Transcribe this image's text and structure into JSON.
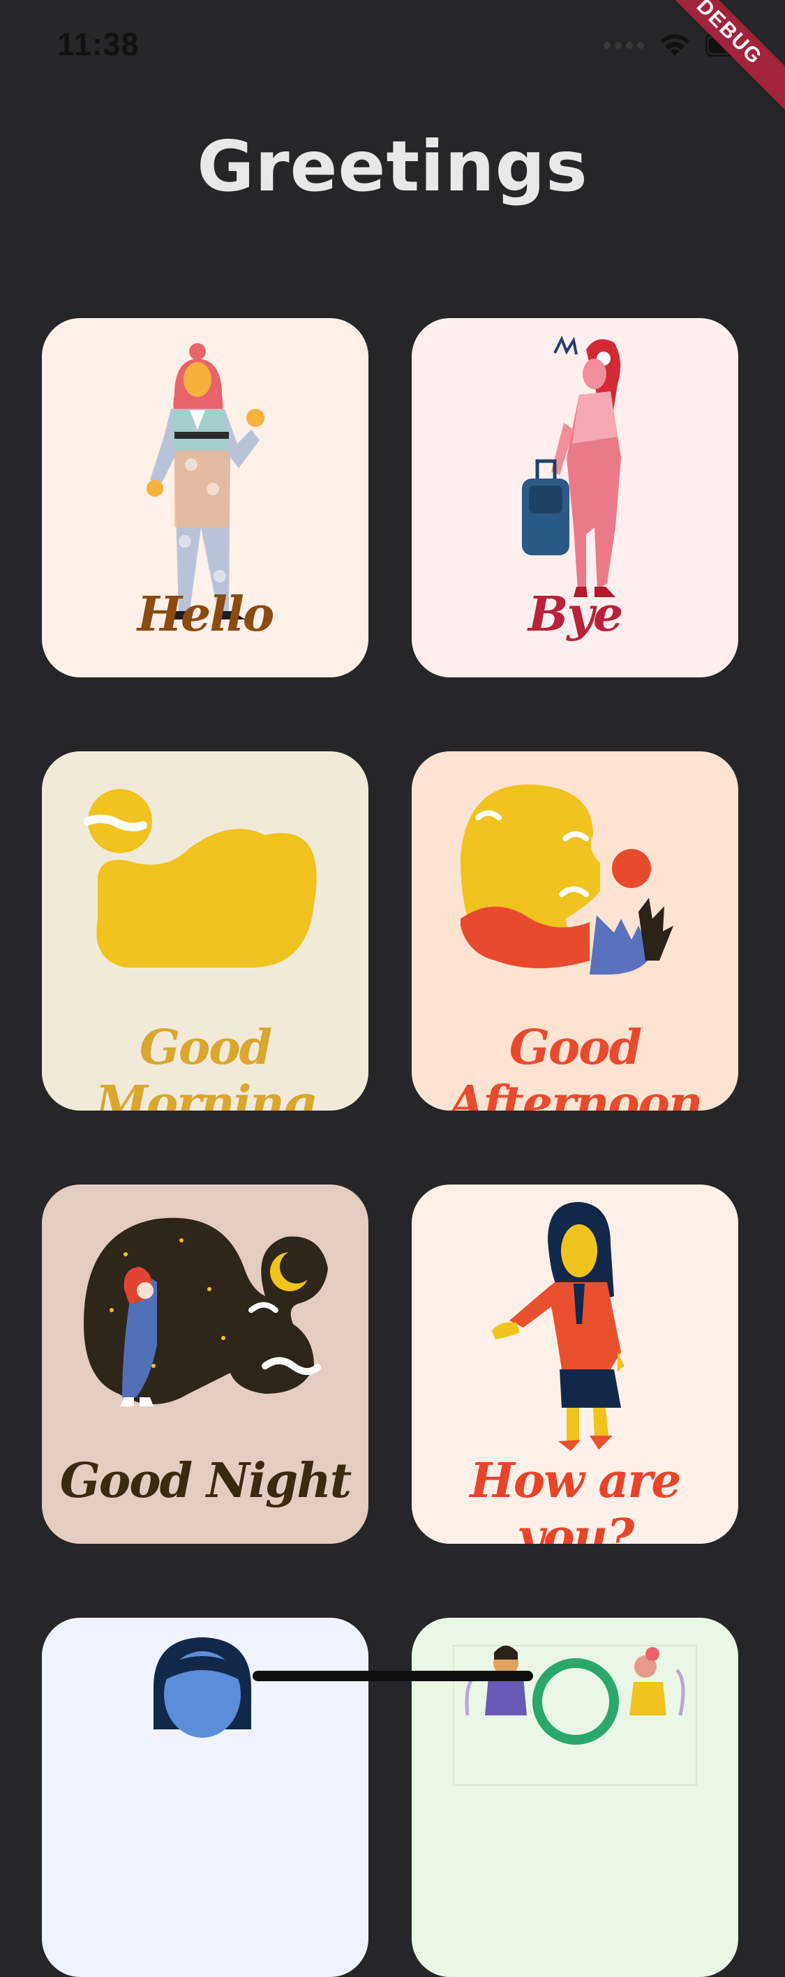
{
  "status_bar": {
    "time": "11:38",
    "banner": "DEBUG"
  },
  "page": {
    "title": "Greetings"
  },
  "cards": [
    {
      "label": "Hello",
      "background": "#fdf0e8",
      "label_color": "#8b4a10",
      "icon": "waving-woman-icon"
    },
    {
      "label": "Bye",
      "background": "#fcefee",
      "label_color": "#b8223a",
      "icon": "woman-with-suitcase-icon"
    },
    {
      "label": "Good Morning",
      "background": "#f2ead9",
      "label_color": "#d9a62e",
      "icon": "morning-sun-icon"
    },
    {
      "label": "Good Afternoon",
      "background": "#fde3d1",
      "label_color": "#e84a2e",
      "icon": "afternoon-landscape-icon"
    },
    {
      "label": "Good Night",
      "background": "#e3ccc0",
      "label_color": "#3a2a12",
      "icon": "night-sky-icon"
    },
    {
      "label": "How are you?",
      "background": "#fdf0e8",
      "label_color": "#e8442a",
      "icon": "businesswoman-handshake-icon"
    },
    {
      "label": "",
      "background": "#eef3fd",
      "label_color": "#1a2a4a",
      "icon": "man-portrait-icon"
    },
    {
      "label": "",
      "background": "#eaf7e6",
      "label_color": "#2a6a2a",
      "icon": "people-meeting-icon"
    }
  ],
  "colors": {
    "screen_background": "#262628",
    "title_color": "#e8e8e8"
  }
}
